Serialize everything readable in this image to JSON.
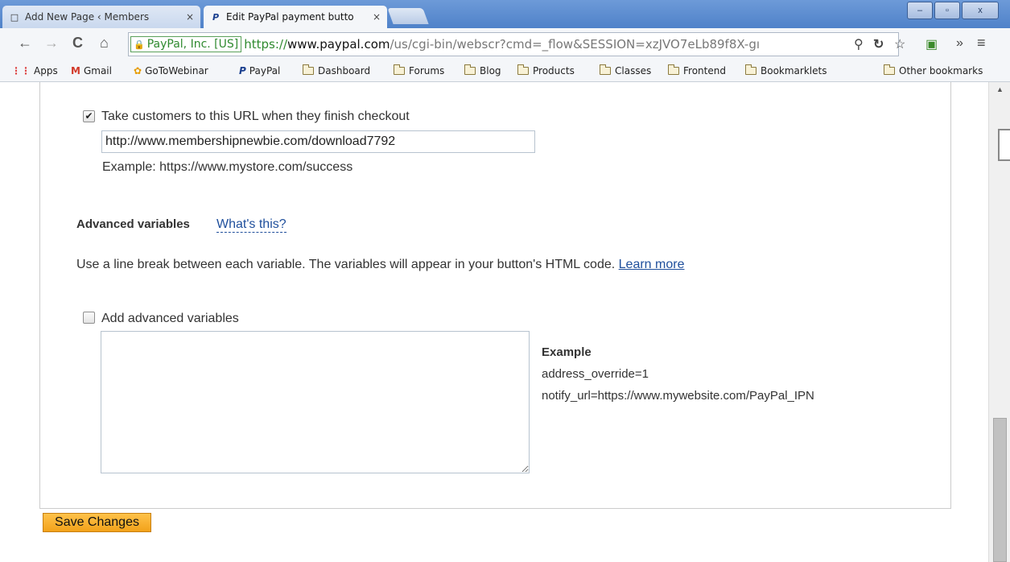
{
  "tabs": [
    {
      "title": "Add New Page ‹ Members",
      "close": "×",
      "active": false
    },
    {
      "title": "Edit PayPal payment butto",
      "close": "×",
      "active": true
    }
  ],
  "window_controls": {
    "minimize": "–",
    "maximize": "▫",
    "close": "x"
  },
  "toolbar": {
    "back": "←",
    "forward": "→",
    "reload": "C",
    "home": "⌂",
    "ev_label": "PayPal, Inc. [US]",
    "url_scheme": "https://",
    "url_host": "www.paypal.com",
    "url_path": "/us/cgi-bin/webscr?cmd=_flow&SESSION=xzJVO7eLb89f8X-gı",
    "overflow": "»",
    "menu": "≡"
  },
  "bookmarks": [
    {
      "label": "Apps",
      "icon": "apps-icon"
    },
    {
      "label": "Gmail",
      "icon": "gmail-icon"
    },
    {
      "label": "GoToWebinar",
      "icon": "gotowebinar-icon"
    },
    {
      "label": "PayPal",
      "icon": "paypal-icon"
    },
    {
      "label": "Dashboard",
      "icon": "folder-icon"
    },
    {
      "label": "Forums",
      "icon": "folder-icon"
    },
    {
      "label": "Blog",
      "icon": "folder-icon"
    },
    {
      "label": "Products",
      "icon": "folder-icon"
    },
    {
      "label": "Classes",
      "icon": "folder-icon"
    },
    {
      "label": "Frontend",
      "icon": "folder-icon"
    },
    {
      "label": "Bookmarklets",
      "icon": "folder-icon"
    }
  ],
  "other_bookmarks": "Other bookmarks",
  "form": {
    "checkout_checkbox_label": "Take customers to this URL when they finish checkout",
    "checkout_checked": true,
    "checkout_url_value": "http://www.membershipnewbie.com/download7792",
    "checkout_example": "Example: https://www.mystore.com/success",
    "advanced_heading": "Advanced variables",
    "whats_this": "What's this?",
    "advanced_desc": "Use a line break between each variable. The variables will appear in your button's HTML code.",
    "learn_more": "Learn more",
    "add_vars_label": "Add advanced variables",
    "add_vars_checked": false,
    "example_heading": "Example",
    "example_line1": "address_override=1",
    "example_line2": "notify_url=https://www.mywebsite.com/PayPal_IPN",
    "save_button": "Save Changes"
  },
  "colors": {
    "save_button": "#f7b02a",
    "link": "#1f4f9c",
    "ev_green": "#2f8a2f"
  }
}
